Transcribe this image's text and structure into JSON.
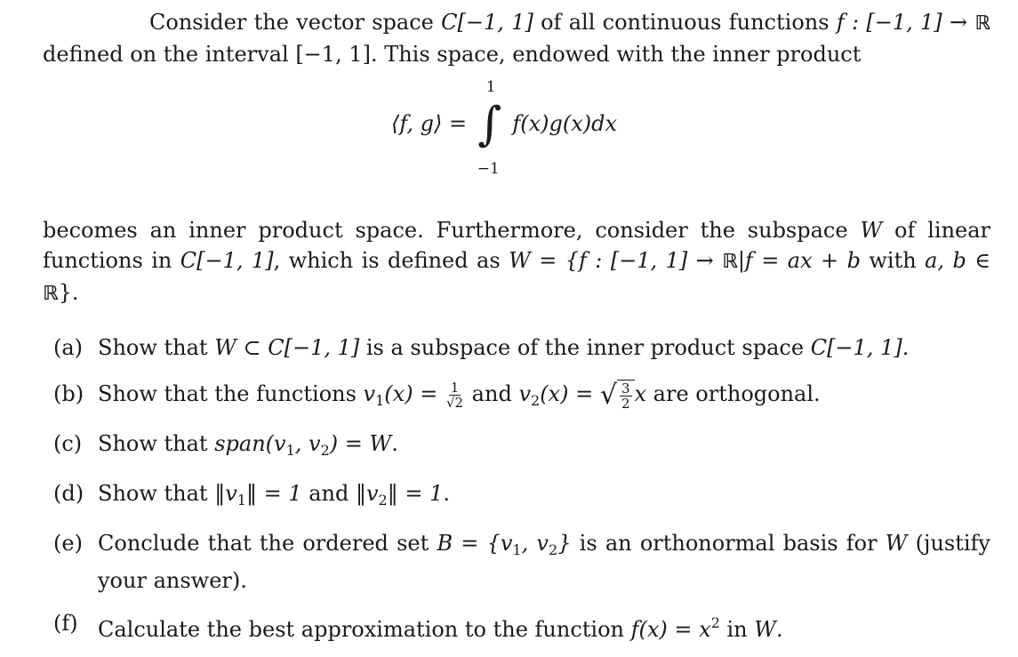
{
  "intro": {
    "line1_prefix": "Consider the vector space ",
    "space": "C[−1, 1]",
    "line1_mid": " of all continuous functions ",
    "map": "f : [−1, 1] → ",
    "reals": "ℝ",
    "line2": "defined on the interval [−1, 1]. This space, endowed with the inner product"
  },
  "inner_product": {
    "lhs": "⟨f, g⟩ = ",
    "upper": "1",
    "lower": "−1",
    "integrand": "f(x)g(x)dx",
    "integral_sign": "∫"
  },
  "definition": {
    "text1": "becomes an inner product space. Furthermore, consider the subspace ",
    "W": "W",
    "text2": " of linear functions in ",
    "space": "C[−1, 1]",
    "text3": ", which is defined as ",
    "set_def": "W = {f : [−1, 1] → ",
    "reals": "ℝ",
    "set_def2": "|f = ax + b",
    "text4": " with ",
    "ab": "a, b ∈ ",
    "reals2": "ℝ",
    "close": "}."
  },
  "items": [
    {
      "label": "(a)",
      "t1": "Show that ",
      "m1": "W ⊂ C[−1, 1]",
      "t2": " is a subspace of the inner product space ",
      "m2": "C[−1, 1]",
      "t3": "."
    },
    {
      "label": "(b)",
      "t1": "Show that the functions ",
      "m1": "v",
      "s1": "1",
      "m1b": "(x) = ",
      "frac_num": "1",
      "frac_den": "√2",
      "t2": " and ",
      "m2": "v",
      "s2": "2",
      "m2b": "(x) = ",
      "sqrt_num": "3",
      "sqrt_den": "2",
      "m3": "x",
      "t3": " are orthogonal."
    },
    {
      "label": "(c)",
      "t1": "Show that ",
      "m1": "span(v",
      "s1": "1",
      "m1b": ", v",
      "s2": "2",
      "m1c": ") = W",
      "t2": "."
    },
    {
      "label": "(d)",
      "t1": "Show that ",
      "m1": "‖v",
      "s1": "1",
      "m1b": "‖ = 1",
      "t2": " and ",
      "m2": "‖v",
      "s2": "2",
      "m2b": "‖ = 1",
      "t3": "."
    },
    {
      "label": "(e)",
      "t1": "Conclude that the ordered set ",
      "m1": "B = {v",
      "s1": "1",
      "m1b": ", v",
      "s2": "2",
      "m1c": "}",
      "t2": " is an orthonormal basis for ",
      "m2": "W",
      "t3": " (justify your answer)."
    },
    {
      "label": "(f)",
      "t1": "Calculate the best approximation to the function ",
      "m1": "f(x) = x",
      "sup": "2",
      "t2": " in ",
      "m2": "W",
      "t3": "."
    }
  ]
}
